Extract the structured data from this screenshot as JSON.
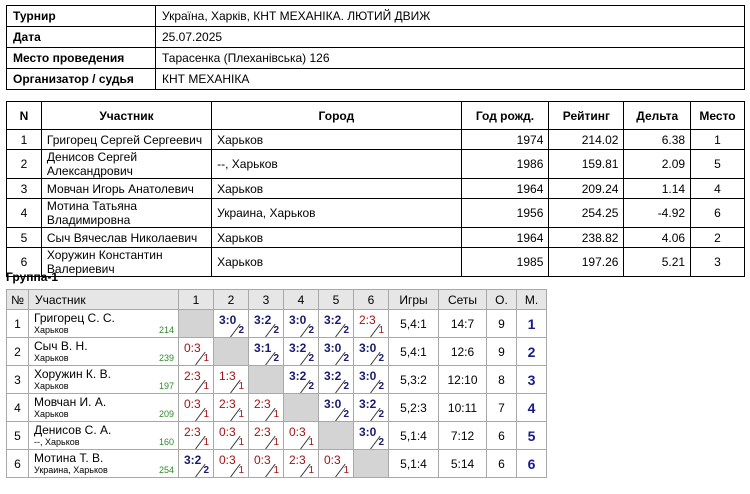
{
  "info": [
    {
      "label": "Турнир",
      "value": "Україна, Харків, КНТ МЕХАНІКА. ЛЮТИЙ ДВИЖ"
    },
    {
      "label": "Дата",
      "value": "25.07.2025"
    },
    {
      "label": "Место проведения",
      "value": "Тарасенка (Плеханівська) 126"
    },
    {
      "label": "Организатор / судья",
      "value": "КНТ МЕХАНІКА"
    }
  ],
  "participants": {
    "headers": [
      "N",
      "Участник",
      "Город",
      "Год рожд.",
      "Рейтинг",
      "Дельта",
      "Место"
    ],
    "rows": [
      [
        "1",
        "Григорец Сергей Сергеевич",
        "Харьков",
        "1974",
        "214.02",
        "6.38",
        "1"
      ],
      [
        "2",
        "Денисов Сергей Александрович",
        "--, Харьков",
        "1986",
        "159.81",
        "2.09",
        "5"
      ],
      [
        "3",
        "Мовчан Игорь Анатолевич",
        "Харьков",
        "1964",
        "209.24",
        "1.14",
        "4"
      ],
      [
        "4",
        "Мотина Татьяна Владимировна",
        "Украина, Харьков",
        "1956",
        "254.25",
        "-4.92",
        "6"
      ],
      [
        "5",
        "Сыч Вячеслав Николаевич",
        "Харьков",
        "1964",
        "238.82",
        "4.06",
        "2"
      ],
      [
        "6",
        "Хоружин Константин Валериевич",
        "Харьков",
        "1985",
        "197.26",
        "5.21",
        "3"
      ]
    ]
  },
  "group": {
    "title": "Группа-1",
    "headers": [
      "№",
      "Участник",
      "1",
      "2",
      "3",
      "4",
      "5",
      "6",
      "Игры",
      "Сеты",
      "О.",
      "М."
    ],
    "rows": [
      {
        "n": "1",
        "name": "Григорец С. С.",
        "city": "Харьков",
        "rating": "214",
        "cells": [
          null,
          [
            "3:0",
            "2",
            "w"
          ],
          [
            "3:2",
            "2",
            "w"
          ],
          [
            "3:0",
            "2",
            "w"
          ],
          [
            "3:2",
            "2",
            "w"
          ],
          [
            "2:3",
            "1",
            "l"
          ]
        ],
        "games": "5,4:1",
        "sets": "14:7",
        "points": "9",
        "place": "1"
      },
      {
        "n": "2",
        "name": "Сыч В. Н.",
        "city": "Харьков",
        "rating": "239",
        "cells": [
          [
            "0:3",
            "1",
            "l"
          ],
          null,
          [
            "3:1",
            "2",
            "w"
          ],
          [
            "3:2",
            "2",
            "w"
          ],
          [
            "3:0",
            "2",
            "w"
          ],
          [
            "3:0",
            "2",
            "w"
          ]
        ],
        "games": "5,4:1",
        "sets": "12:6",
        "points": "9",
        "place": "2"
      },
      {
        "n": "3",
        "name": "Хоружин К. В.",
        "city": "Харьков",
        "rating": "197",
        "cells": [
          [
            "2:3",
            "1",
            "l"
          ],
          [
            "1:3",
            "1",
            "l"
          ],
          null,
          [
            "3:2",
            "2",
            "w"
          ],
          [
            "3:2",
            "2",
            "w"
          ],
          [
            "3:0",
            "2",
            "w"
          ]
        ],
        "games": "5,3:2",
        "sets": "12:10",
        "points": "8",
        "place": "3"
      },
      {
        "n": "4",
        "name": "Мовчан И. А.",
        "city": "Харьков",
        "rating": "209",
        "cells": [
          [
            "0:3",
            "1",
            "l"
          ],
          [
            "2:3",
            "1",
            "l"
          ],
          [
            "2:3",
            "1",
            "l"
          ],
          null,
          [
            "3:0",
            "2",
            "w"
          ],
          [
            "3:2",
            "2",
            "w"
          ]
        ],
        "games": "5,2:3",
        "sets": "10:11",
        "points": "7",
        "place": "4"
      },
      {
        "n": "5",
        "name": "Денисов С. А.",
        "city": "--, Харьков",
        "rating": "160",
        "cells": [
          [
            "2:3",
            "1",
            "l"
          ],
          [
            "0:3",
            "1",
            "l"
          ],
          [
            "2:3",
            "1",
            "l"
          ],
          [
            "0:3",
            "1",
            "l"
          ],
          null,
          [
            "3:0",
            "2",
            "w"
          ]
        ],
        "games": "5,1:4",
        "sets": "7:12",
        "points": "6",
        "place": "5"
      },
      {
        "n": "6",
        "name": "Мотина Т. В.",
        "city": "Украина, Харьков",
        "rating": "254",
        "cells": [
          [
            "3:2",
            "2",
            "w"
          ],
          [
            "0:3",
            "1",
            "l"
          ],
          [
            "0:3",
            "1",
            "l"
          ],
          [
            "2:3",
            "1",
            "l"
          ],
          [
            "0:3",
            "1",
            "l"
          ],
          null
        ],
        "games": "5,1:4",
        "sets": "5:14",
        "points": "6",
        "place": "6"
      }
    ]
  },
  "colors": {
    "win": "#1a1a6e",
    "loss": "#a01414",
    "rating": "#2a8a2a",
    "place": "#1a1a8a",
    "header_bg": "#e6e6e6",
    "diagonal": "#d4d4d4"
  }
}
